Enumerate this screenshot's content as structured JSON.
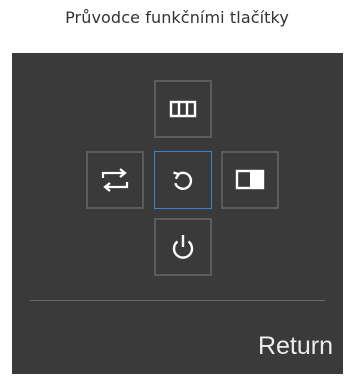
{
  "caption": "Průvodce funkčními tlačítky",
  "panel": {
    "keys": {
      "up": {
        "icon": "menu-grid-icon"
      },
      "left": {
        "icon": "swap-arrows-icon"
      },
      "center": {
        "icon": "return-icon",
        "selected": true
      },
      "right": {
        "icon": "picture-mode-icon"
      },
      "down": {
        "icon": "power-icon"
      }
    },
    "selected_label": "Return"
  },
  "colors": {
    "panel_background": "#3a3a3a",
    "key_border": "#5c5c5c",
    "selected_border": "#3d82d1",
    "icon": "#ffffff",
    "text": "#ececec"
  }
}
